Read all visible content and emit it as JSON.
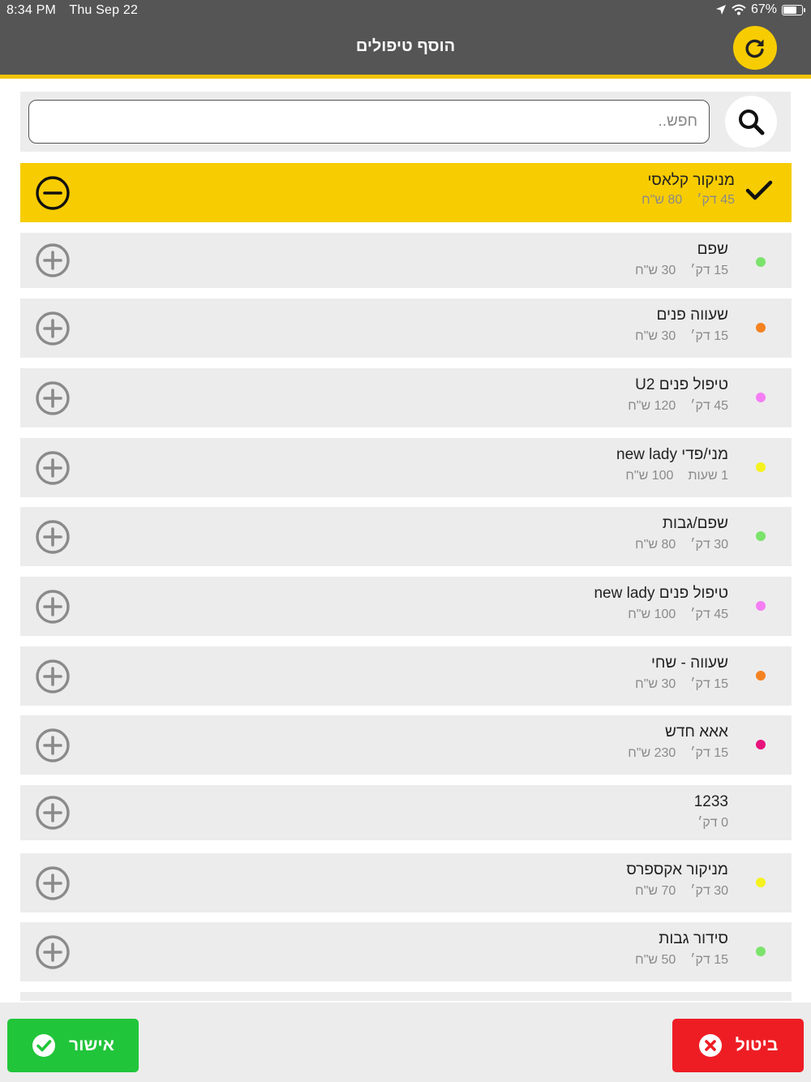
{
  "status_bar": {
    "time": "8:34 PM",
    "date": "Thu Sep 22",
    "battery": "67%"
  },
  "header": {
    "title": "הוסף טיפולים",
    "refresh_icon": "refresh-icon"
  },
  "search": {
    "placeholder": "חפש..",
    "value": "",
    "icon": "search-icon"
  },
  "treatments": [
    {
      "name": "מניקור קלאסי",
      "duration": "45 דק׳",
      "price": "80 ש\"ח",
      "selected": true,
      "color": ""
    },
    {
      "name": "שפם",
      "duration": "15 דק׳",
      "price": "30 ש\"ח",
      "selected": false,
      "color": "#7be36b"
    },
    {
      "name": "שעווה פנים",
      "duration": "15 דק׳",
      "price": "30 ש\"ח",
      "selected": false,
      "color": "#f58220"
    },
    {
      "name": "טיפול פנים U2",
      "duration": "45 דק׳",
      "price": "120 ש\"ח",
      "selected": false,
      "color": "#f57ef5"
    },
    {
      "name": "מני/פדי new lady",
      "duration": "1 שעות",
      "price": "100 ש\"ח",
      "selected": false,
      "color": "#f5f21f"
    },
    {
      "name": "שפם/גבות",
      "duration": "30 דק׳",
      "price": "80 ש\"ח",
      "selected": false,
      "color": "#7be36b"
    },
    {
      "name": "טיפול פנים new lady",
      "duration": "45 דק׳",
      "price": "100 ש\"ח",
      "selected": false,
      "color": "#f57ef5"
    },
    {
      "name": "שעווה - שחי",
      "duration": "15 דק׳",
      "price": "30 ש\"ח",
      "selected": false,
      "color": "#f58220"
    },
    {
      "name": "אאא חדש",
      "duration": "15 דק׳",
      "price": "230 ש\"ח",
      "selected": false,
      "color": "#e8127d"
    },
    {
      "name": "1233",
      "duration": "0 דק׳",
      "price": "",
      "selected": false,
      "color": ""
    },
    {
      "name": "מניקור אקספרס",
      "duration": "30 דק׳",
      "price": "70 ש\"ח",
      "selected": false,
      "color": "#f5f21f"
    },
    {
      "name": "סידור גבות",
      "duration": "15 דק׳",
      "price": "50 ש\"ח",
      "selected": false,
      "color": "#7be36b"
    },
    {
      "name": "",
      "duration": "",
      "price": "",
      "selected": false,
      "color": ""
    }
  ],
  "footer": {
    "confirm_label": "אישור",
    "cancel_label": "ביטול"
  },
  "colors": {
    "header_bg": "#555555",
    "accent_yellow": "#f7cc00",
    "row_bg": "#ececec",
    "confirm_green": "#21c53a",
    "cancel_red": "#ee1d24"
  }
}
